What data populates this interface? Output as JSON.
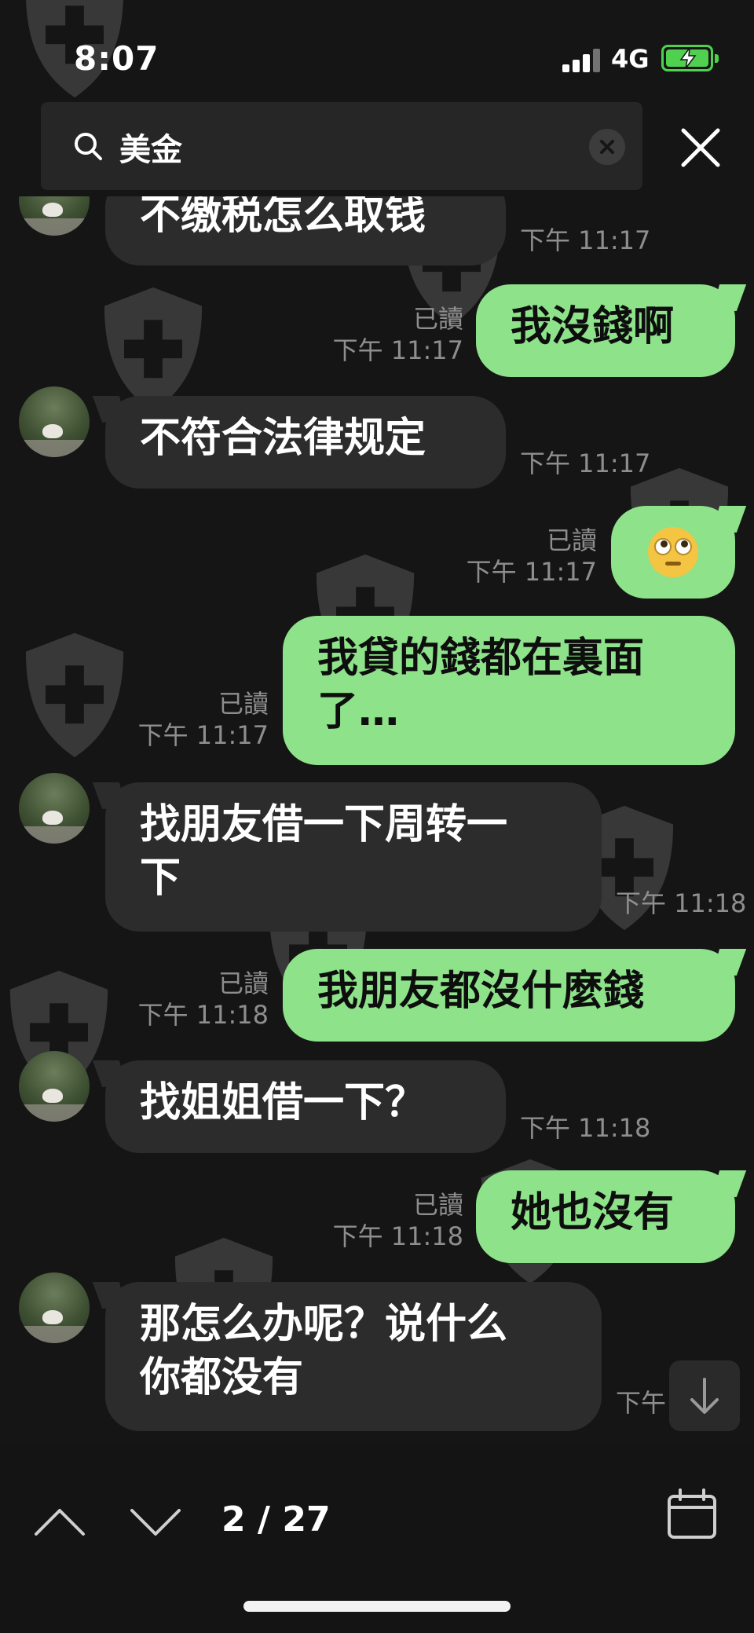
{
  "status_bar": {
    "time": "8:07",
    "network": "4G",
    "battery_state": "charging",
    "icons": [
      "signal-icon",
      "battery-charging-icon"
    ]
  },
  "search": {
    "query": "美金",
    "icons": [
      "search-icon",
      "clear-icon",
      "close-icon"
    ]
  },
  "messages": [
    {
      "direction": "in",
      "text": "不缴税怎么取钱",
      "time": "下午 11:17"
    },
    {
      "direction": "out",
      "text": "我沒錢啊",
      "read": "已讀",
      "time": "下午 11:17"
    },
    {
      "direction": "in",
      "text": "不符合法律规定",
      "time": "下午 11:17"
    },
    {
      "direction": "out",
      "text": "",
      "sticker": "eye-roll-emoji",
      "read": "已讀",
      "time": "下午 11:17"
    },
    {
      "direction": "out",
      "text": "我貸的錢都在裏面\n了…",
      "read": "已讀",
      "time": "下午 11:17"
    },
    {
      "direction": "in",
      "text": "找朋友借一下周转一\n下",
      "time": "下午 11:18"
    },
    {
      "direction": "out",
      "text": "我朋友都沒什麼錢",
      "read": "已讀",
      "time": "下午 11:18"
    },
    {
      "direction": "in",
      "text": "找姐姐借一下？",
      "time": "下午 11:18"
    },
    {
      "direction": "out",
      "text": "她也沒有",
      "read": "已讀",
      "time": "下午 11:18"
    },
    {
      "direction": "in",
      "text": "那怎么办呢？说什么\n你都没有",
      "time": "下午"
    }
  ],
  "bottom_bar": {
    "counter": "2 / 27",
    "icons": [
      "chevron-up-icon",
      "chevron-down-icon",
      "calendar-icon"
    ]
  },
  "colors": {
    "background": "#151515",
    "incoming_bubble": "#2c2c2c",
    "outgoing_bubble": "#8de28a",
    "meta_text": "#8e8e8e",
    "battery": "#4fd14f"
  }
}
